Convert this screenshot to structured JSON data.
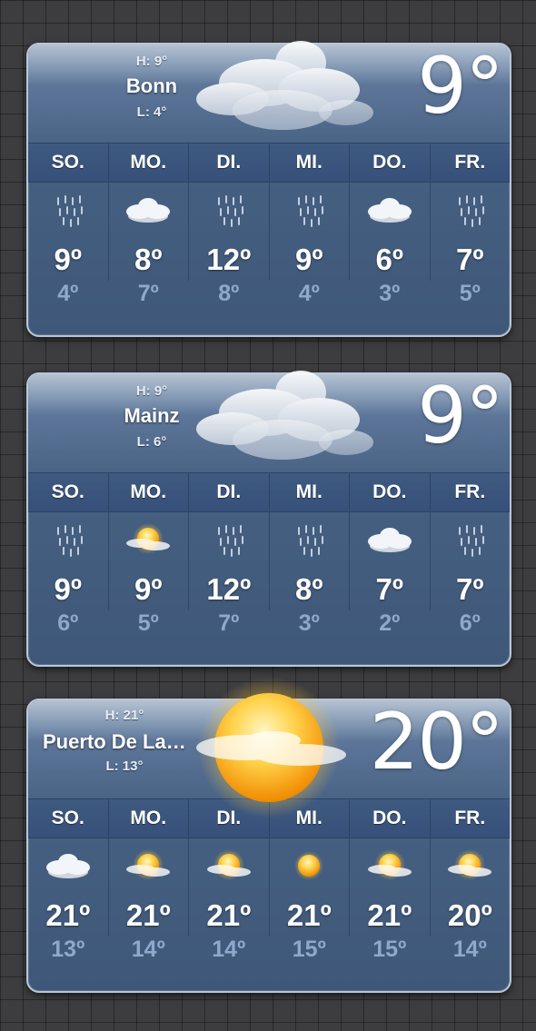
{
  "days": [
    "SO.",
    "MO.",
    "DI.",
    "MI.",
    "DO.",
    "FR."
  ],
  "widgets": [
    {
      "city": "Bonn",
      "high": "H: 9°",
      "low": "L: 4°",
      "current": "9°",
      "condition_icon": "cloud-icon",
      "forecast": [
        {
          "icon": "rain-icon",
          "high": "9º",
          "low": "4º"
        },
        {
          "icon": "cloud-icon",
          "high": "8º",
          "low": "7º"
        },
        {
          "icon": "rain-icon",
          "high": "12º",
          "low": "8º"
        },
        {
          "icon": "rain-icon",
          "high": "9º",
          "low": "4º"
        },
        {
          "icon": "cloud-icon",
          "high": "6º",
          "low": "3º"
        },
        {
          "icon": "rain-icon",
          "high": "7º",
          "low": "5º"
        }
      ]
    },
    {
      "city": "Mainz",
      "high": "H: 9°",
      "low": "L: 6°",
      "current": "9°",
      "condition_icon": "cloud-icon",
      "forecast": [
        {
          "icon": "rain-icon",
          "high": "9º",
          "low": "6º"
        },
        {
          "icon": "sun-cloud-icon",
          "high": "9º",
          "low": "5º"
        },
        {
          "icon": "rain-icon",
          "high": "12º",
          "low": "7º"
        },
        {
          "icon": "rain-icon",
          "high": "8º",
          "low": "3º"
        },
        {
          "icon": "cloud-icon",
          "high": "7º",
          "low": "2º"
        },
        {
          "icon": "rain-icon",
          "high": "7º",
          "low": "6º"
        }
      ]
    },
    {
      "city": "Puerto De La…",
      "high": "H: 21°",
      "low": "L: 13°",
      "current": "20°",
      "condition_icon": "sun-icon",
      "forecast": [
        {
          "icon": "cloud-icon",
          "high": "21º",
          "low": "13º"
        },
        {
          "icon": "sun-cloud-icon",
          "high": "21º",
          "low": "14º"
        },
        {
          "icon": "sun-cloud-icon",
          "high": "21º",
          "low": "14º"
        },
        {
          "icon": "sun-icon",
          "high": "21º",
          "low": "15º"
        },
        {
          "icon": "sun-cloud-icon",
          "high": "21º",
          "low": "15º"
        },
        {
          "icon": "sun-cloud-icon",
          "high": "20º",
          "low": "14º"
        }
      ]
    }
  ]
}
